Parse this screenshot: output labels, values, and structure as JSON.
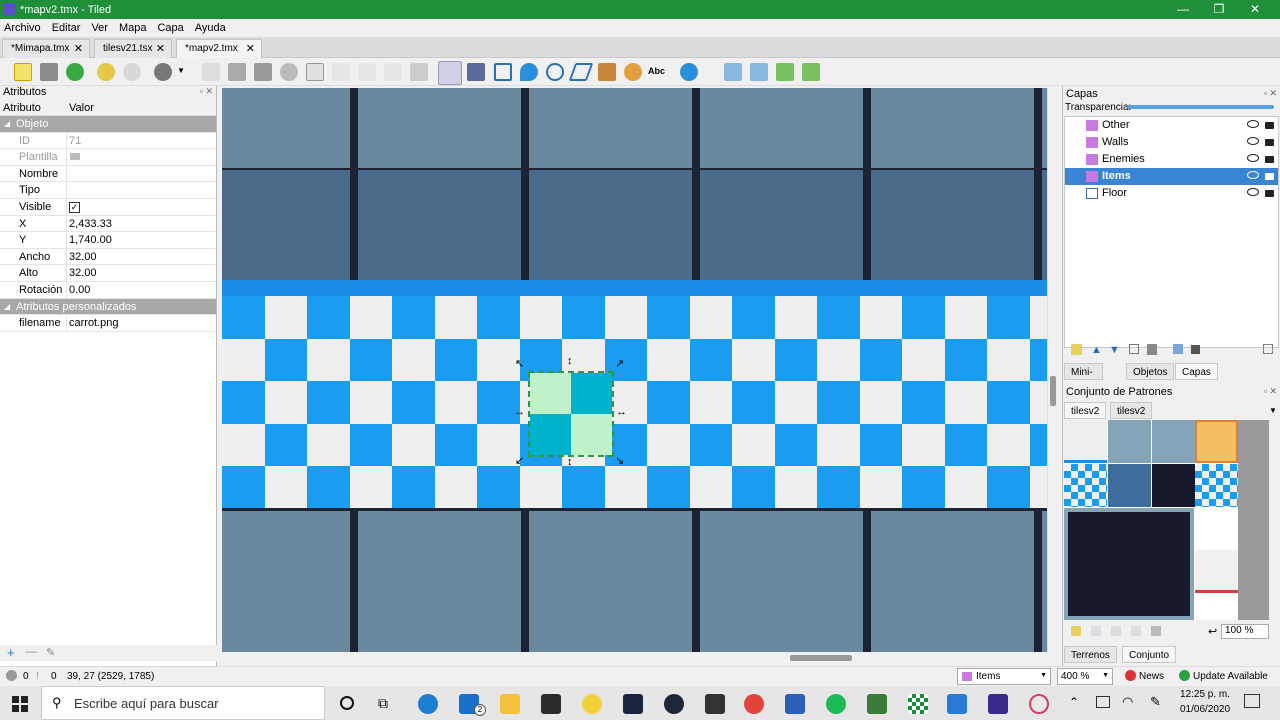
{
  "window": {
    "title": "*mapv2.tmx - Tiled",
    "min": "—",
    "max": "❐",
    "close": "✕"
  },
  "menu": [
    "Archivo",
    "Editar",
    "Ver",
    "Mapa",
    "Capa",
    "Ayuda"
  ],
  "tabs": [
    {
      "label": "*Mimapa.tmx",
      "close": "✕"
    },
    {
      "label": "tilesv21.tsx",
      "close": "✕"
    },
    {
      "label": "*mapv2.tmx",
      "close": "✕"
    }
  ],
  "toolbar": {
    "text_tool_label": "Abc"
  },
  "attributes": {
    "title": "Atributos",
    "col_attr": "Atributo",
    "col_value": "Valor",
    "group_object": "Objeto",
    "id_label": "ID",
    "id_value": "71",
    "template_label": "Plantilla",
    "name_label": "Nombre",
    "type_label": "Tipo",
    "visible_label": "Visible",
    "visible_check": "✓",
    "x_label": "X",
    "x_value": "2,433.33",
    "y_label": "Y",
    "y_value": "1,740.00",
    "width_label": "Ancho",
    "width_value": "32.00",
    "height_label": "Alto",
    "height_value": "32.00",
    "rotation_label": "Rotación",
    "rotation_value": "0.00",
    "group_custom": "Atributos personalizados",
    "filename_label": "filename",
    "filename_value": "carrot.png",
    "add": "+",
    "remove": "—",
    "edit": "✎"
  },
  "layers": {
    "title": "Capas",
    "opacity_label": "Transparencia:",
    "items": [
      "Other",
      "Walls",
      "Enemies",
      "Items",
      "Floor"
    ],
    "tabs": [
      "Mini-mapa",
      "Objetos",
      "Capas"
    ]
  },
  "tilesets": {
    "title": "Conjunto de Patrones",
    "tabs": [
      "tilesv2",
      "tilesv2"
    ],
    "zoom": "100 %",
    "bottom_tabs": [
      "Terrenos",
      "Conjunto de Patrones"
    ]
  },
  "status": {
    "coords": "39, 27 (2529, 1785)",
    "counts_a": "0",
    "counts_b": "0",
    "layer_select": "Items",
    "zoom": "400 %",
    "news": "News",
    "update": "Update Available"
  },
  "taskbar": {
    "search_placeholder": "Escribe aquí para buscar",
    "mail_badge": "2",
    "time": "12:25 p. m.",
    "date": "01/06/2020"
  },
  "colors": {
    "titlebar": "#1f8f3a",
    "selection": "#3a84d4",
    "tile_blue": "#1a9cf0",
    "tile_white": "#efefef",
    "wall": "#4a6a8a"
  }
}
